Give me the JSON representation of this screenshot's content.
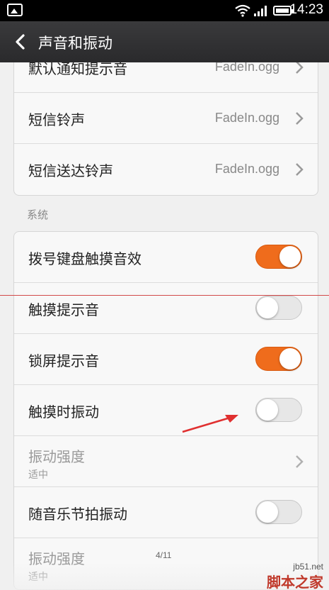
{
  "status_bar": {
    "time": "14:23"
  },
  "title_bar": {
    "title": "声音和振动"
  },
  "card_top": {
    "partial_label": "默认通知提示音",
    "partial_value": "FadeIn.ogg",
    "items": [
      {
        "label": "短信铃声",
        "value": "FadeIn.ogg"
      },
      {
        "label": "短信送达铃声",
        "value": "FadeIn.ogg"
      }
    ]
  },
  "system_section": {
    "header": "系统",
    "items": [
      {
        "label": "拨号键盘触摸音效",
        "toggle": "on"
      },
      {
        "label": "触摸提示音",
        "toggle": "off"
      },
      {
        "label": "锁屏提示音",
        "toggle": "on"
      },
      {
        "label": "触摸时振动",
        "toggle": "off"
      },
      {
        "label": "振动强度",
        "sub": "适中",
        "disabled": true
      },
      {
        "label": "随音乐节拍振动",
        "toggle": "off"
      },
      {
        "label": "振动强度",
        "sub": "适中",
        "disabled": true
      }
    ]
  },
  "page_indicator": "4/11",
  "watermark": {
    "url": "jb51.net",
    "brand": "脚本之家"
  },
  "colors": {
    "toggle_on": "#ef6c1c",
    "title_bar": "#2f2f31",
    "annotation": "#e03030"
  }
}
